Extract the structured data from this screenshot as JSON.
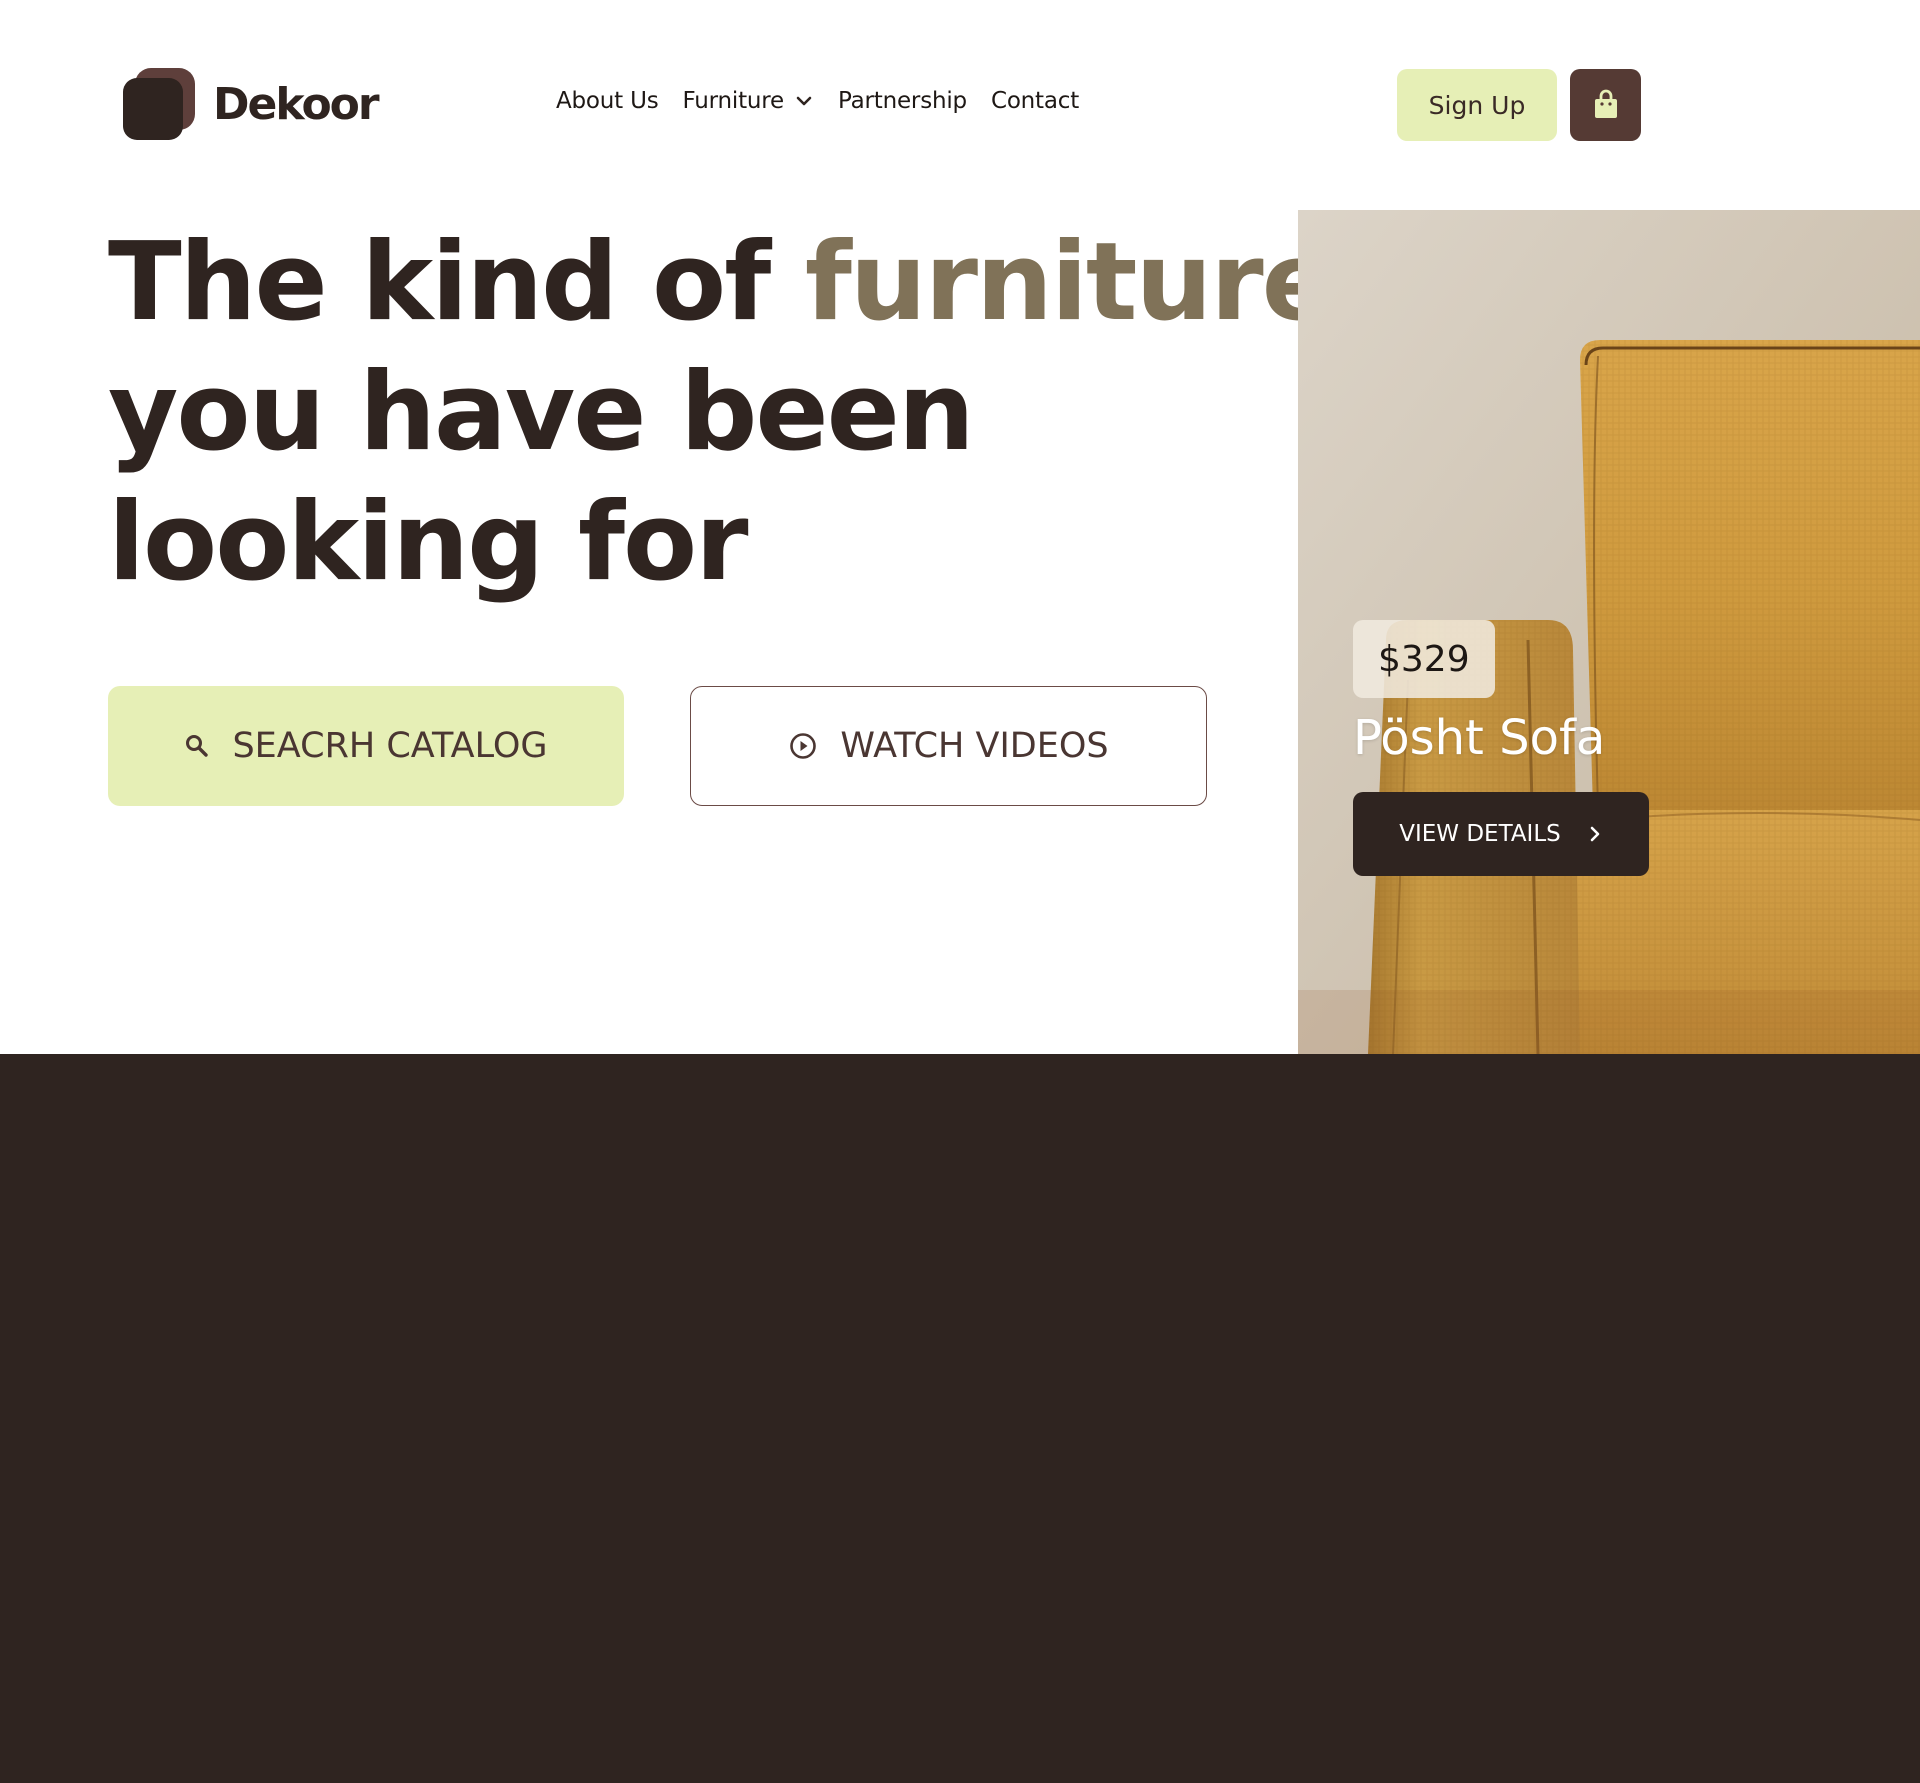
{
  "brand": {
    "name": "Dekoor"
  },
  "nav": {
    "items": [
      {
        "label": "About Us"
      },
      {
        "label": "Furniture",
        "has_dropdown": true
      },
      {
        "label": "Partnership"
      },
      {
        "label": "Contact"
      }
    ]
  },
  "header": {
    "signup_label": "Sign Up",
    "cart_icon": "shopping-bag-icon"
  },
  "hero": {
    "headline_part1": "The kind of ",
    "headline_accent": "furniture",
    "headline_line2": "you have been",
    "headline_line3": "looking for",
    "search_button": {
      "label": "SEACRH CATALOG",
      "icon": "search-icon"
    },
    "watch_button": {
      "label": "WATCH VIDEOS",
      "icon": "play-circle-icon"
    }
  },
  "product": {
    "price": "$329",
    "name": "Pösht Sofa",
    "cta_label": "VIEW DETAILS",
    "cta_icon": "chevron-right-icon"
  },
  "colors": {
    "dark_brown": "#2f2420",
    "accent_olive": "#807258",
    "lime": "#e6efb6",
    "cart_brown": "#553a34",
    "sofa_mustard": "#c99a3a"
  }
}
